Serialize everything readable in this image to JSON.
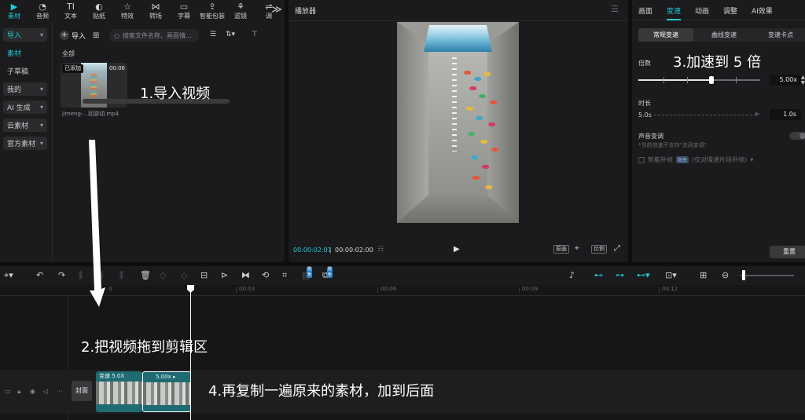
{
  "tool_tabs": [
    {
      "icon": "▶",
      "label": "素材",
      "active": true
    },
    {
      "icon": "◔",
      "label": "音频"
    },
    {
      "icon": "TI",
      "label": "文本"
    },
    {
      "icon": "◐",
      "label": "贴纸"
    },
    {
      "icon": "☆",
      "label": "特效"
    },
    {
      "icon": "⋈",
      "label": "转场"
    },
    {
      "icon": "▭",
      "label": "字幕"
    },
    {
      "icon": "⇪",
      "label": "智能包装"
    },
    {
      "icon": "⚘",
      "label": "滤镜"
    },
    {
      "icon": "⇌",
      "label": "调"
    }
  ],
  "more_icon": "≫",
  "media_nav": [
    {
      "label": "导入",
      "chevron": "▾",
      "boxed": true,
      "active": true
    },
    {
      "label": "素材",
      "active": true
    },
    {
      "label": "子草稿"
    },
    {
      "label": "我的",
      "chevron": "▾",
      "boxed": true
    },
    {
      "label": "AI 生成",
      "chevron": "▾",
      "boxed": true
    },
    {
      "label": "云素材",
      "chevron": "▾",
      "boxed": true
    },
    {
      "label": "官方素材",
      "chevron": "▾",
      "boxed": true
    }
  ],
  "media_toolbar": {
    "import_label": "导入",
    "search_placeholder": "搜索文件名称、画面情...",
    "sort_icon": "☰",
    "filter_icon": "⊤"
  },
  "media_section": "全部",
  "media_card": {
    "badge": "已添加",
    "duration": "00:06",
    "filename": "jimeng-...回游动.mp4"
  },
  "annotations": {
    "step1": "1.导入视频",
    "step2": "2.把视频拖到剪辑区",
    "step3": "3.加速到 5 倍",
    "step4": "4.再复制一遍原来的素材，加到后面"
  },
  "player": {
    "title": "播放器",
    "menu_icon": "☰",
    "current_time": "00:00:02:01",
    "total_time": "00:00:02:00",
    "original_label": "原画",
    "ratio_label": "比例"
  },
  "props": {
    "tabs": [
      "画面",
      "变速",
      "动画",
      "调整",
      "AI效果"
    ],
    "active_tab": "变速",
    "modes": [
      "常规变速",
      "曲线变速",
      "变速卡点"
    ],
    "active_mode": "常规变速",
    "multiplier_label": "倍数",
    "speed_value": "5.00x",
    "speed_fraction": 0.6,
    "duration_label": "时长",
    "duration_from": "5.0s",
    "duration_to": "1.0s",
    "pitch_label": "声音变调",
    "pitch_note": "*当前倍速不支持\"关闭变调\"",
    "smart_frame_label": "智能补帧",
    "smart_frame_tag": "限免",
    "smart_frame_note": "(仅对慢速片段补帧)",
    "reset_label": "重置"
  },
  "timeline_toolbar": {
    "free_badge": "限免"
  },
  "ruler_labels": [
    "00:03",
    "00:06",
    "00:09",
    "00:12"
  ],
  "track": {
    "cover_label": "封面",
    "clip1_label": "变速 5.0X",
    "clip2_label": "5.00x ▸"
  },
  "colors": {
    "accent": "#1ec9d4",
    "panel": "#1b1b1d",
    "background": "#0e0e10",
    "clip": "#1f6b73"
  }
}
